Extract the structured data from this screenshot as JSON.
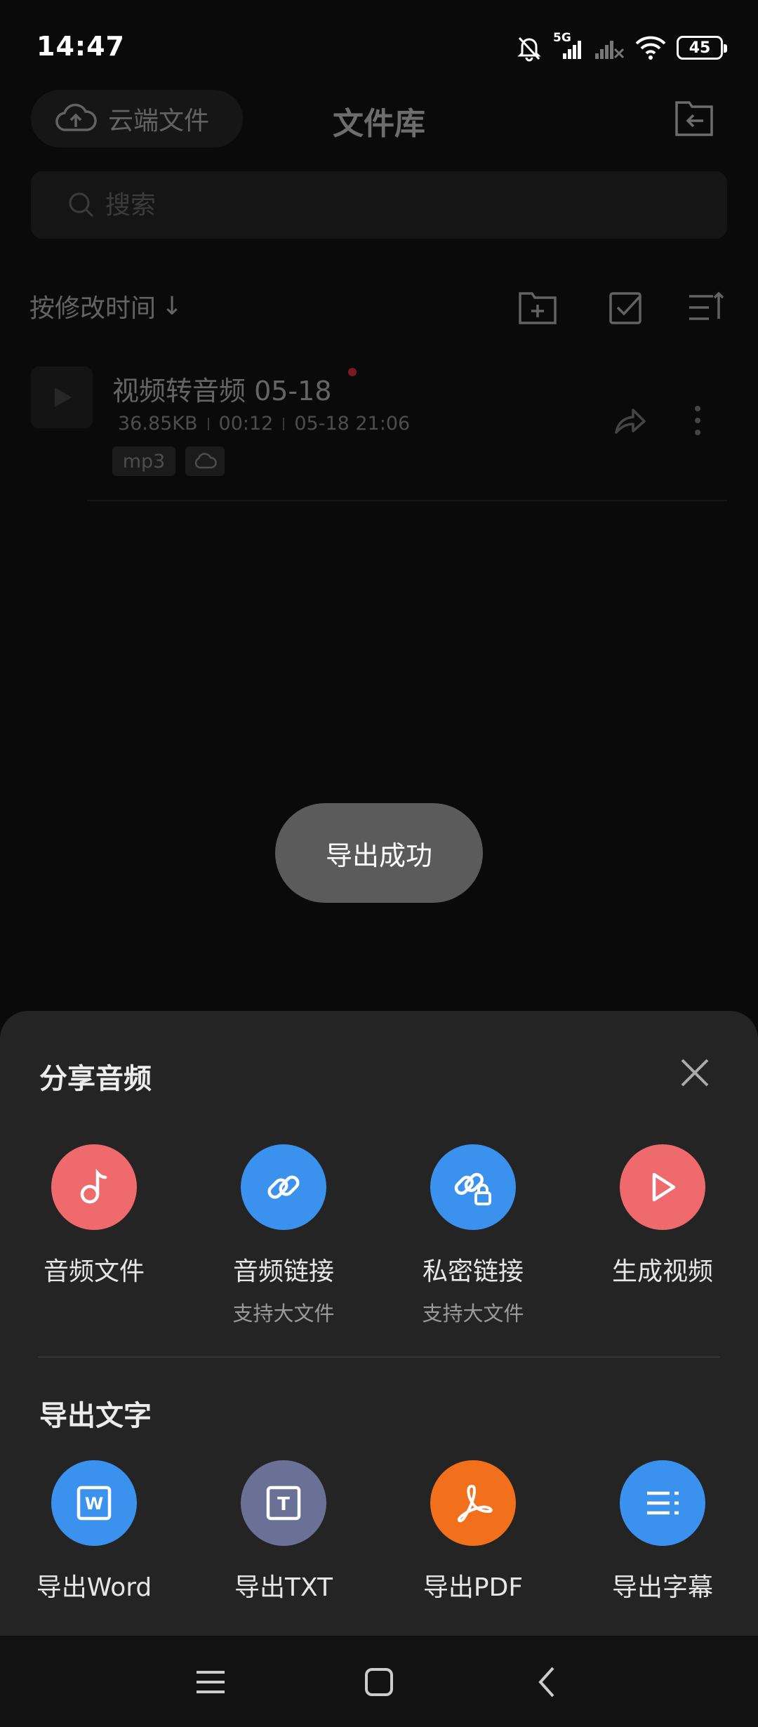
{
  "status_bar": {
    "time": "14:47",
    "network": "5G",
    "battery": "45",
    "icons": [
      "mute-bell-icon",
      "signal-5g-icon",
      "signal-empty-icon",
      "wifi-icon",
      "battery-icon"
    ]
  },
  "header": {
    "cloud_button_label": "云端文件",
    "title": "文件库",
    "import_icon": "folder-import-icon"
  },
  "search": {
    "placeholder": "搜索"
  },
  "toolbar": {
    "sort_label": "按修改时间",
    "sort_arrow": "↓",
    "icons": [
      "new-folder-icon",
      "multi-select-icon",
      "sort-list-icon"
    ]
  },
  "files": [
    {
      "name": "视频转音频 05-18",
      "size": "36.85KB",
      "duration": "00:12",
      "modified": "05-18 21:06",
      "tags": [
        "mp3"
      ],
      "unread": true
    }
  ],
  "toast": {
    "text": "导出成功"
  },
  "share_sheet": {
    "title": "分享音频",
    "options": [
      {
        "label": "音频文件",
        "sub": "",
        "icon": "music-note-icon",
        "color": "#ee6a6c"
      },
      {
        "label": "音频链接",
        "sub": "支持大文件",
        "icon": "link-icon",
        "color": "#3a91ee"
      },
      {
        "label": "私密链接",
        "sub": "支持大文件",
        "icon": "lock-link-icon",
        "color": "#3a91ee"
      },
      {
        "label": "生成视频",
        "sub": "",
        "icon": "play-icon",
        "color": "#ee6a6c"
      }
    ]
  },
  "export_text": {
    "title": "导出文字",
    "options": [
      {
        "label": "导出Word",
        "icon": "word-icon",
        "icon_text": "W",
        "color": "#3a91ee"
      },
      {
        "label": "导出TXT",
        "icon": "txt-icon",
        "icon_text": "T",
        "color": "#6b7196"
      },
      {
        "label": "导出PDF",
        "icon": "pdf-icon",
        "icon_text": "",
        "color": "#f26f1b"
      },
      {
        "label": "导出字幕",
        "icon": "subtitle-icon",
        "icon_text": "",
        "color": "#3a91ee"
      }
    ]
  },
  "nav_bar": {
    "icons": [
      "menu-icon",
      "home-icon",
      "back-icon"
    ]
  }
}
